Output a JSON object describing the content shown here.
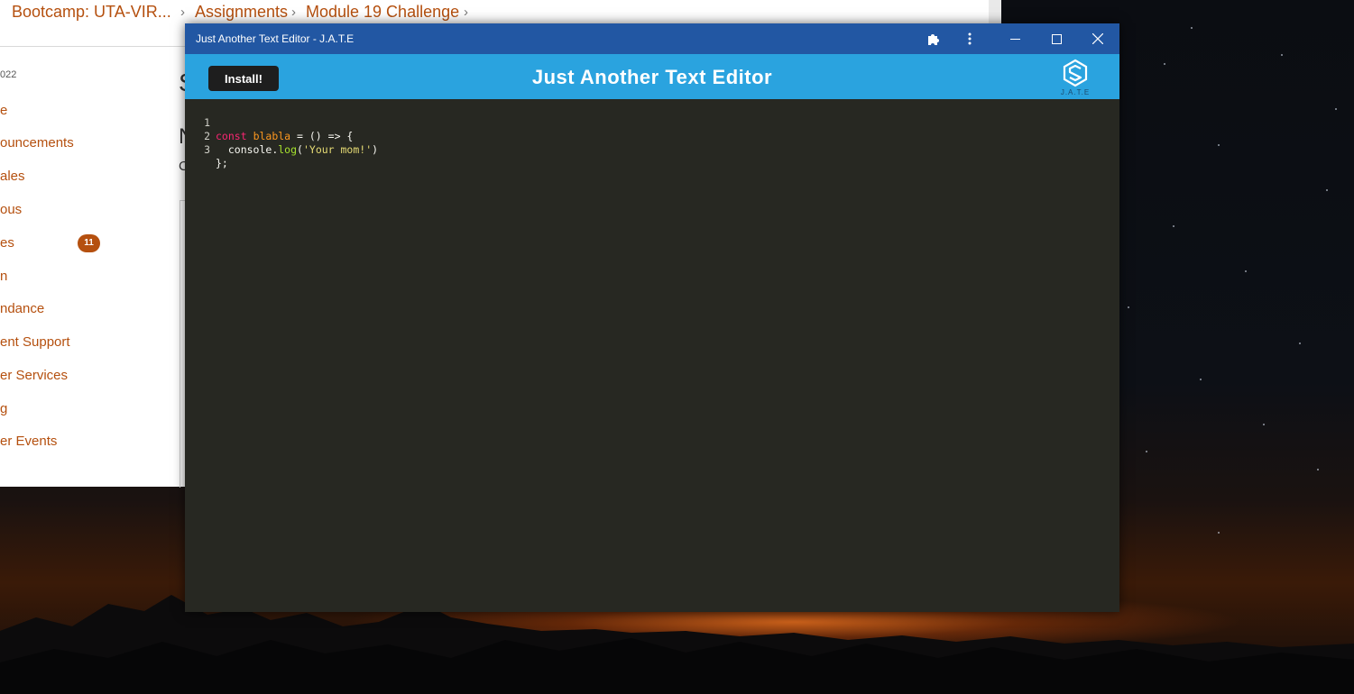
{
  "lms": {
    "breadcrumb": [
      "Bootcamp: UTA-VIR...",
      "Assignments",
      "Module 19 Challenge"
    ],
    "date_fragment": "022",
    "nav_items": [
      "e",
      "ouncements",
      "ales",
      "ous",
      "es",
      "n",
      "ndance",
      "ent Support",
      "er Services",
      "g",
      "er Events"
    ],
    "badge_count": "11",
    "peek_heading_1": "S",
    "peek_heading_2": "N",
    "peek_text": "C"
  },
  "app": {
    "window_title": "Just Another Text Editor - J.A.T.E",
    "install_label": "Install!",
    "heading": "Just Another Text Editor",
    "logo_text": "J.A.T.E",
    "titlebar_icons": [
      "extensions-icon",
      "more-vertical-icon",
      "minimize-icon",
      "maximize-icon",
      "close-icon"
    ],
    "colors": {
      "titlebar": "#2257a3",
      "header": "#2aa3df",
      "editor_bg": "#272822",
      "lms_accent": "#b5500f"
    },
    "code": {
      "line_numbers": [
        "1",
        "2",
        "3"
      ],
      "line1": {
        "kw": "const",
        "name": "blabla",
        "rest": " = () => {"
      },
      "line2": {
        "indent": "  ",
        "obj": "console.",
        "fn": "log",
        "open": "(",
        "str": "'Your mom!'",
        "close": ")"
      },
      "line3": {
        "text": "};"
      }
    }
  }
}
